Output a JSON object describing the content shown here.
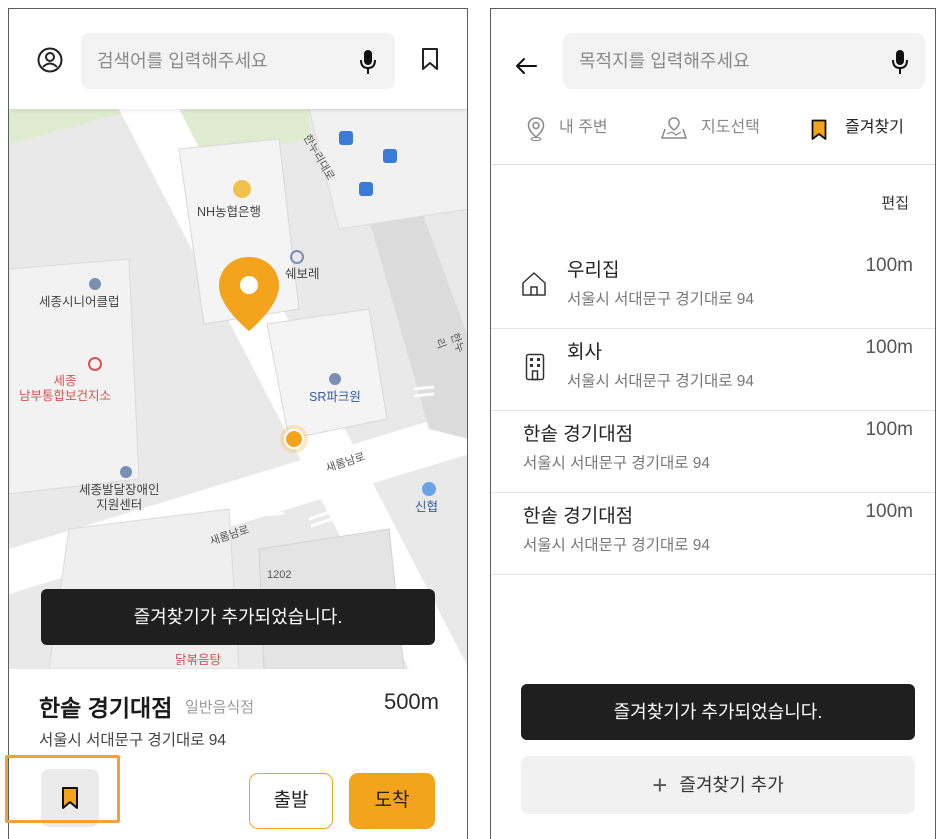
{
  "left_screen": {
    "search": {
      "placeholder": "검색어를 입력해주세요"
    },
    "map": {
      "pois": [
        {
          "name": "NH농협은행"
        },
        {
          "name": "쉐보레"
        },
        {
          "name": "세종시니어클럽"
        },
        {
          "name": "세종\n남부통합보건지소"
        },
        {
          "name": "SR파크원"
        },
        {
          "name": "세종발달장애인\n지원센터"
        },
        {
          "name": "신협"
        },
        {
          "name": "닭볶음탕"
        }
      ],
      "roads": [
        {
          "name": "한누리대로"
        },
        {
          "name": "새롬남로"
        },
        {
          "name": "새롬남로"
        },
        {
          "name": "1202"
        },
        {
          "name": "한누리"
        }
      ]
    },
    "toast": "즐겨찾기가 추가되었습니다.",
    "place": {
      "name": "한솥 경기대점",
      "category": "일반음식점",
      "distance": "500m",
      "address": "서울시 서대문구 경기대로 94"
    },
    "buttons": {
      "depart": "출발",
      "arrive": "도착"
    },
    "colors": {
      "accent": "#f4a31d",
      "highlight": "#f5a13b",
      "toast_bg": "#1f1f1f"
    }
  },
  "right_screen": {
    "search": {
      "placeholder": "목적지를 입력해주세요"
    },
    "tabs": [
      {
        "label": "내 주변",
        "icon": "location-pin-icon"
      },
      {
        "label": "지도선택",
        "icon": "map-select-icon"
      },
      {
        "label": "즐겨찾기",
        "icon": "bookmark-icon"
      }
    ],
    "edit_label": "편집",
    "favorites": [
      {
        "name": "우리집",
        "address": "서울시 서대문구 경기대로 94",
        "distance": "100m",
        "icon": "home-icon"
      },
      {
        "name": "회사",
        "address": "서울시 서대문구 경기대로 94",
        "distance": "100m",
        "icon": "building-icon"
      },
      {
        "name": "한솥 경기대점",
        "address": "서울시 서대문구 경기대로 94",
        "distance": "100m",
        "icon": ""
      },
      {
        "name": "한솥 경기대점",
        "address": "서울시 서대문구 경기대로 94",
        "distance": "100m",
        "icon": ""
      }
    ],
    "toast": "즐겨찾기가 추가되었습니다.",
    "add_favorite_label": "즐겨찾기 추가"
  }
}
